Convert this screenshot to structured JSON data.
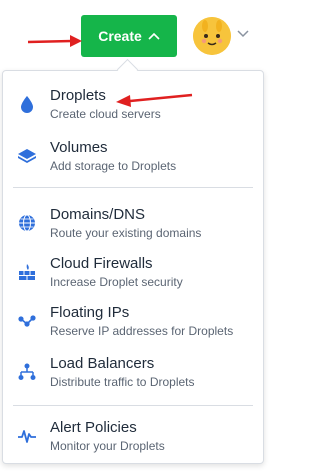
{
  "header": {
    "create_label": "Create",
    "create_icon": "chevron-up-icon",
    "avatar_icon": "bunny-avatar",
    "account_caret_icon": "chevron-down-icon",
    "accent_color": "#15b54a"
  },
  "menu": {
    "items": [
      {
        "title": "Droplets",
        "subtitle": "Create cloud servers",
        "icon": "droplet-icon"
      },
      {
        "title": "Volumes",
        "subtitle": "Add storage to Droplets",
        "icon": "volume-icon"
      },
      {
        "title": "Domains/DNS",
        "subtitle": "Route your existing domains",
        "icon": "globe-icon"
      },
      {
        "title": "Cloud Firewalls",
        "subtitle": "Increase Droplet security",
        "icon": "firewall-icon"
      },
      {
        "title": "Floating IPs",
        "subtitle": "Reserve IP addresses for Droplets",
        "icon": "floating-ip-icon"
      },
      {
        "title": "Load Balancers",
        "subtitle": "Distribute traffic to Droplets",
        "icon": "load-balancer-icon"
      },
      {
        "title": "Alert Policies",
        "subtitle": "Monitor your Droplets",
        "icon": "alert-policy-icon"
      }
    ],
    "icon_color": "#2f6fdb"
  },
  "annotations": {
    "arrow_color": "#e02020"
  }
}
